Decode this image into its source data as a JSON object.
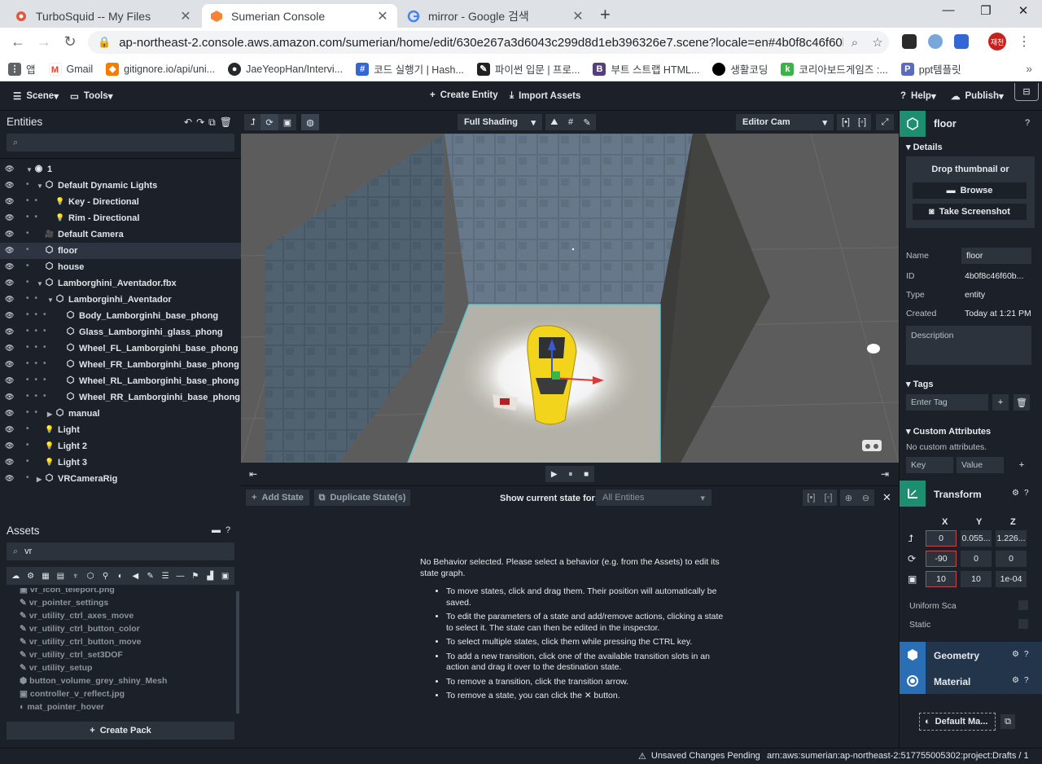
{
  "browser": {
    "tabs": [
      {
        "title": "TurboSquid -- My Files",
        "icon": "turbosquid-icon",
        "active": false
      },
      {
        "title": "Sumerian Console",
        "icon": "sumerian-icon",
        "active": true
      },
      {
        "title": "mirror - Google 검색",
        "icon": "google-icon",
        "active": false
      }
    ],
    "url": "ap-northeast-2.console.aws.amazon.com/sumerian/home/edit/630e267a3d6043c299d8d1eb396326e7.scene?locale=en#4b0f8c46f60b485...",
    "profile_label": "재천",
    "bookmarks": [
      {
        "label": "앱",
        "icon": "apps-icon"
      },
      {
        "label": "Gmail",
        "icon": "gmail-icon"
      },
      {
        "label": "gitignore.io/api/uni...",
        "icon": "gitignore-icon"
      },
      {
        "label": "JaeYeopHan/Intervi...",
        "icon": "github-icon"
      },
      {
        "label": "코드 실행기 | Hash...",
        "icon": "hash-icon"
      },
      {
        "label": "파이썬 입문 | 프로...",
        "icon": "python-icon"
      },
      {
        "label": "부트 스트랩 HTML...",
        "icon": "bootstrap-icon"
      },
      {
        "label": "생활코딩",
        "icon": "opentutorials-icon"
      },
      {
        "label": "코리아보드게임즈 :...",
        "icon": "koreaboardgames-icon"
      },
      {
        "label": "ppt템플릿",
        "icon": "ppt-icon"
      }
    ]
  },
  "app": {
    "menu": {
      "scene": "Scene",
      "tools": "Tools",
      "create_entity": "Create Entity",
      "import_assets": "Import Assets",
      "help": "Help",
      "publish": "Publish"
    },
    "entities": {
      "title": "Entities",
      "tree": [
        {
          "label": "1",
          "depth": 0,
          "icon": "scene-icon",
          "arrow": "down"
        },
        {
          "label": "Default Dynamic Lights",
          "depth": 1,
          "icon": "entity-icon",
          "arrow": "down"
        },
        {
          "label": "Key - Directional",
          "depth": 2,
          "icon": "light-icon",
          "arrow": ""
        },
        {
          "label": "Rim - Directional",
          "depth": 2,
          "icon": "light-icon",
          "arrow": ""
        },
        {
          "label": "Default Camera",
          "depth": 1,
          "icon": "camera-icon",
          "arrow": ""
        },
        {
          "label": "floor",
          "depth": 1,
          "icon": "entity-icon",
          "arrow": "",
          "selected": true
        },
        {
          "label": "house",
          "depth": 1,
          "icon": "entity-icon",
          "arrow": ""
        },
        {
          "label": "Lamborghini_Aventador.fbx",
          "depth": 1,
          "icon": "entity-icon",
          "arrow": "down"
        },
        {
          "label": "Lamborginhi_Aventador",
          "depth": 2,
          "icon": "entity-icon",
          "arrow": "down"
        },
        {
          "label": "Body_Lamborginhi_base_phong",
          "depth": 3,
          "icon": "entity-icon",
          "arrow": ""
        },
        {
          "label": "Glass_Lamborginhi_glass_phong",
          "depth": 3,
          "icon": "entity-icon",
          "arrow": ""
        },
        {
          "label": "Wheel_FL_Lamborginhi_base_phong",
          "depth": 3,
          "icon": "entity-icon",
          "arrow": ""
        },
        {
          "label": "Wheel_FR_Lamborginhi_base_phong",
          "depth": 3,
          "icon": "entity-icon",
          "arrow": ""
        },
        {
          "label": "Wheel_RL_Lamborginhi_base_phong",
          "depth": 3,
          "icon": "entity-icon",
          "arrow": ""
        },
        {
          "label": "Wheel_RR_Lamborginhi_base_phong",
          "depth": 3,
          "icon": "entity-icon",
          "arrow": ""
        },
        {
          "label": "manual",
          "depth": 2,
          "icon": "entity-icon",
          "arrow": "right"
        },
        {
          "label": "Light",
          "depth": 1,
          "icon": "light-icon",
          "arrow": ""
        },
        {
          "label": "Light 2",
          "depth": 1,
          "icon": "light-icon",
          "arrow": ""
        },
        {
          "label": "Light 3",
          "depth": 1,
          "icon": "light-icon",
          "arrow": ""
        },
        {
          "label": "VRCameraRig",
          "depth": 1,
          "icon": "entity-icon",
          "arrow": "right"
        }
      ]
    },
    "assets": {
      "title": "Assets",
      "search_value": "vr",
      "items": [
        {
          "label": "vr_icon_teleport.png",
          "icon": "image-icon"
        },
        {
          "label": "vr_pointer_settings",
          "icon": "script-icon"
        },
        {
          "label": "vr_utility_ctrl_axes_move",
          "icon": "script-icon"
        },
        {
          "label": "vr_utility_ctrl_button_color",
          "icon": "script-icon"
        },
        {
          "label": "vr_utility_ctrl_button_move",
          "icon": "script-icon"
        },
        {
          "label": "vr_utility_ctrl_set3DOF",
          "icon": "script-icon"
        },
        {
          "label": "vr_utility_setup",
          "icon": "script-icon"
        },
        {
          "label": "button_volume_grey_shiny_Mesh",
          "icon": "mesh-icon"
        },
        {
          "label": "controller_v_reflect.jpg",
          "icon": "image-icon"
        },
        {
          "label": "mat_pointer_hover",
          "icon": "material-icon"
        }
      ],
      "create_pack": "Create Pack"
    },
    "viewport": {
      "shading": "Full Shading",
      "camera": "Editor Cam"
    },
    "state_machine": {
      "add_state": "Add State",
      "duplicate_state": "Duplicate State(s)",
      "show_label": "Show current state for:",
      "show_value": "All Entities",
      "intro": "No Behavior selected. Please select a behavior (e.g. from the Assets) to edit its state graph.",
      "tips": [
        "To move states, click and drag them. Their position will automatically be saved.",
        "To edit the parameters of a state and add/remove actions, clicking a state to select it. The state can then be edited in the inspector.",
        "To select multiple states, click them while pressing the CTRL key.",
        "To add a new transition, click one of the available transition slots in an action and drag it over to the destination state.",
        "To remove a transition, click the transition arrow.",
        "To remove a state, you can click the ✕ button."
      ]
    },
    "inspector": {
      "entity_name": "floor",
      "details_label": "Details",
      "drop_thumbnail": "Drop thumbnail or",
      "browse": "Browse",
      "take_screenshot": "Take Screenshot",
      "name_label": "Name",
      "name_value": "floor",
      "id_label": "ID",
      "id_value": "4b0f8c46f60b...",
      "type_label": "Type",
      "type_value": "entity",
      "created_label": "Created",
      "created_value": "Today at 1:21 PM",
      "description_placeholder": "Description",
      "tags_label": "Tags",
      "tag_placeholder": "Enter Tag",
      "custom_attr_label": "Custom Attributes",
      "no_custom": "No custom attributes.",
      "key_placeholder": "Key",
      "value_placeholder": "Value",
      "transform_label": "Transform",
      "axes": [
        "X",
        "Y",
        "Z"
      ],
      "translation": [
        "0",
        "0.055...",
        "1.226..."
      ],
      "rotation": [
        "-90",
        "0",
        "0"
      ],
      "scale": [
        "10",
        "10",
        "1e-04"
      ],
      "uniform_scale": "Uniform Sca",
      "static": "Static",
      "geometry_label": "Geometry",
      "material_label": "Material",
      "default_material": "Default Ma..."
    },
    "status": {
      "unsaved": "Unsaved Changes Pending",
      "arn": "arn:aws:sumerian:ap-northeast-2:517755005302:project:Drafts / 1"
    }
  }
}
